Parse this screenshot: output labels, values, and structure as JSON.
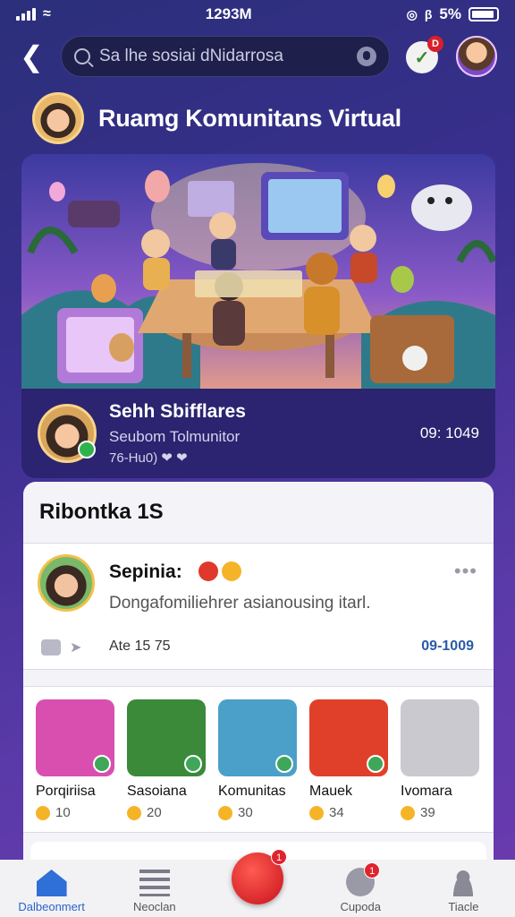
{
  "status_bar": {
    "time": "1293M",
    "battery": "5%"
  },
  "search": {
    "placeholder": "Sa lhe sosiai dNidarrosa"
  },
  "notifications": {
    "badge": "D"
  },
  "header": {
    "title": "Ruamg Komunitans Virtual"
  },
  "hero": {
    "name": "Sehh Sbifflares",
    "subtitle": "Seubom Tolmunitor",
    "meta": "76-Hu0) ❤ ❤",
    "time": "09: 1049"
  },
  "panel": {
    "title": "Ribontka 1S",
    "post": {
      "name": "Sepinia:",
      "body": "Dongafomiliehrer asianousing itarl.",
      "stat": "Ate 15 75",
      "time": "09-1009"
    },
    "communities": [
      {
        "name": "Porqiriisa",
        "count": "10",
        "color": "#d94fb0"
      },
      {
        "name": "Sasoiana",
        "count": "20",
        "color": "#3a8a3a"
      },
      {
        "name": "Komunitas",
        "count": "30",
        "color": "#4aa0c8"
      },
      {
        "name": "Mauek",
        "count": "34",
        "color": "#e0402a"
      },
      {
        "name": "Ivomara",
        "count": "39",
        "color": "#c9c9cf"
      }
    ]
  },
  "bottom_nav": {
    "items": [
      {
        "label": "Dalbeonmert"
      },
      {
        "label": "Neoclan"
      },
      {
        "label": "",
        "badge": "1"
      },
      {
        "label": "Cupoda",
        "badge": "1"
      },
      {
        "label": "Tiacle"
      }
    ]
  }
}
